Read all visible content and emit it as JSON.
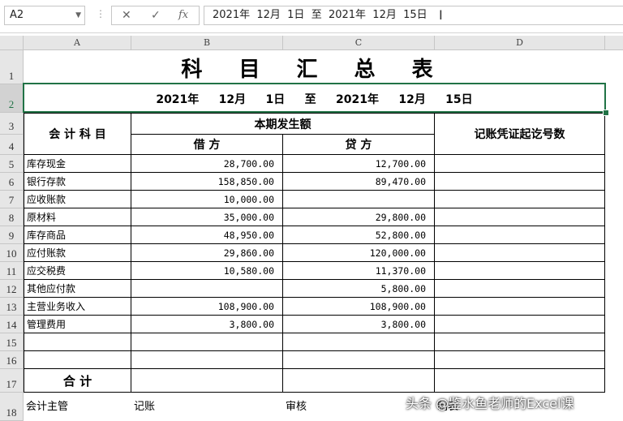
{
  "name_box": "A2",
  "formula_bar": {
    "cancel_icon": "✕",
    "enter_icon": "✓",
    "fx_label": "fx",
    "content": "2021年  12月  1日  至  2021年  12月  15日"
  },
  "columns": [
    "A",
    "B",
    "C",
    "D"
  ],
  "row_numbers": [
    "1",
    "2",
    "3",
    "4",
    "5",
    "6",
    "7",
    "8",
    "9",
    "10",
    "11",
    "12",
    "13",
    "14",
    "15",
    "16",
    "17",
    "18"
  ],
  "sheet": {
    "title": "科 目 汇 总 表",
    "date_line": "2021年     12月     1日     至     2021年     12月     15日",
    "subject_header": "会 计 科 目",
    "period_header": "本期发生额",
    "debit_header": "借       方",
    "credit_header": "贷       方",
    "voucher_header": "记账凭证起讫号数",
    "total_label": "合    计",
    "rows": [
      {
        "subject": "库存现金",
        "debit": "28,700.00",
        "credit": "12,700.00"
      },
      {
        "subject": "银行存款",
        "debit": "158,850.00",
        "credit": "89,470.00"
      },
      {
        "subject": "应收账款",
        "debit": "10,000.00",
        "credit": ""
      },
      {
        "subject": "原材料",
        "debit": "35,000.00",
        "credit": "29,800.00"
      },
      {
        "subject": "库存商品",
        "debit": "48,950.00",
        "credit": "52,800.00"
      },
      {
        "subject": "应付账款",
        "debit": "29,860.00",
        "credit": "120,000.00"
      },
      {
        "subject": "应交税费",
        "debit": "10,580.00",
        "credit": "11,370.00"
      },
      {
        "subject": "其他应付款",
        "debit": "",
        "credit": "5,800.00"
      },
      {
        "subject": "主营业务收入",
        "debit": "108,900.00",
        "credit": "108,900.00"
      },
      {
        "subject": "管理费用",
        "debit": "3,800.00",
        "credit": "3,800.00"
      }
    ],
    "footer": {
      "supervisor": "会计主管",
      "bookkeeper": "记账",
      "reviewer": "审核",
      "preparer": "制表"
    }
  },
  "watermark": "头条 @鉴水鱼老师的Excel课"
}
